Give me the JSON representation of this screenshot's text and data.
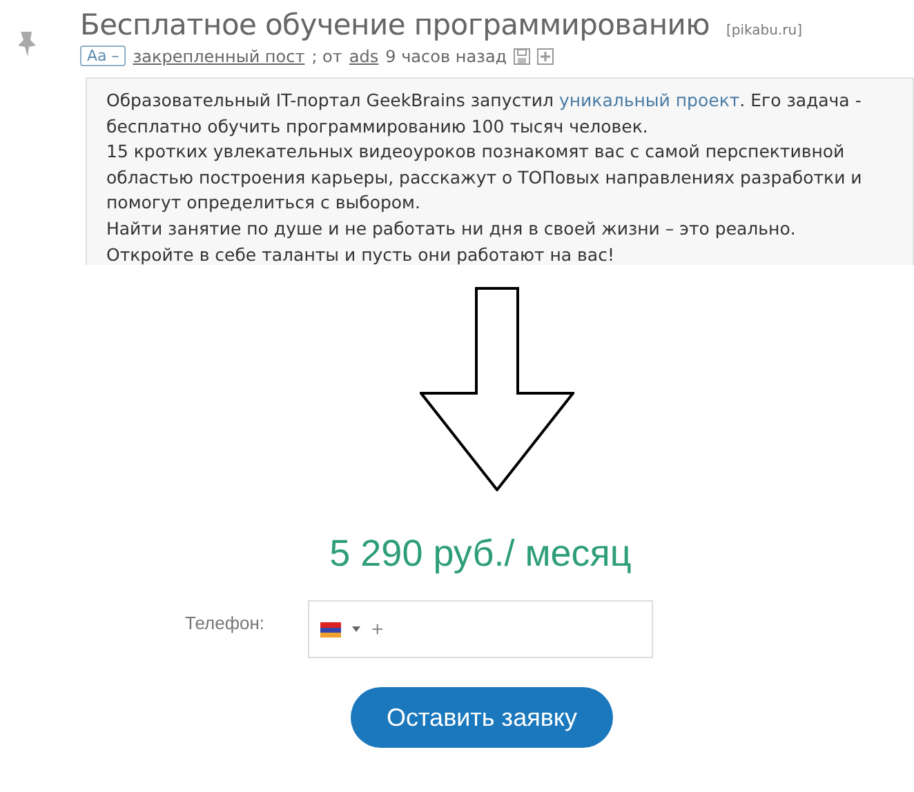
{
  "post": {
    "title": "Бесплатное обучение программированию",
    "source": "[pikabu.ru]",
    "font_toggle": "Aa –",
    "meta": [
      {
        "kind": "link",
        "text": "закрепленный пост"
      },
      {
        "kind": "text",
        "text": "; от"
      },
      {
        "kind": "link",
        "text": "ads"
      },
      {
        "kind": "text",
        "text": "9 часов назад"
      }
    ],
    "paragraphs": [
      {
        "parts": [
          {
            "kind": "text",
            "text": "Образовательный IT-портал GeekBrains запустил "
          },
          {
            "kind": "link",
            "text": "уникальный проект"
          },
          {
            "kind": "text",
            "text": ". Его задача - бесплатно обучить программированию 100 тысяч человек."
          }
        ]
      },
      {
        "parts": [
          {
            "kind": "text",
            "text": "15 кротких увлекательных видеоуроков познакомят вас с самой перспективной областью построения карьеры, расскажут о ТОПовых направлениях разработки и помогут определиться с выбором."
          }
        ]
      },
      {
        "parts": [
          {
            "kind": "text",
            "text": "Найти занятие по душе и не работать ни дня в своей жизни – это реально."
          }
        ]
      },
      {
        "parts": [
          {
            "kind": "text",
            "text": "Откройте в себе таланты и пусть они работают на вас!"
          }
        ]
      }
    ]
  },
  "price": "5 290 руб./ месяц",
  "phone": {
    "label": "Телефон:",
    "prefix": "+"
  },
  "submit": "Оставить заявку"
}
